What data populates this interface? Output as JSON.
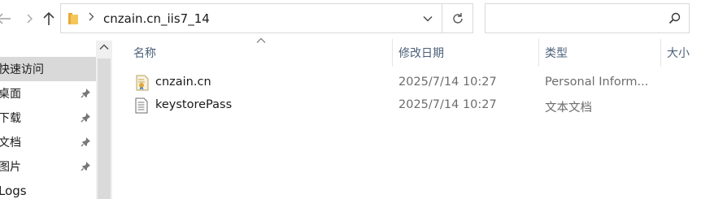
{
  "address": {
    "path": "cnzain.cn_iis7_14",
    "search_placeholder": ""
  },
  "icons": {
    "back": "arrow-left-icon",
    "forward": "chevron-right-icon",
    "up": "arrow-up-icon",
    "folder": "folder-icon",
    "dropdown": "chevron-down-icon",
    "refresh": "refresh-icon",
    "search": "search-icon",
    "pin": "pin-icon"
  },
  "nav": {
    "header": "快速访问",
    "items": [
      {
        "label": "桌面",
        "pinned": true
      },
      {
        "label": "下载",
        "pinned": true
      },
      {
        "label": "文档",
        "pinned": true
      },
      {
        "label": "图片",
        "pinned": true
      },
      {
        "label": "Logs",
        "pinned": false
      }
    ]
  },
  "columns": {
    "name": "名称",
    "date": "修改日期",
    "type": "类型",
    "size": "大小"
  },
  "files": [
    {
      "name": "cnzain.cn",
      "date": "2025/7/14 10:27",
      "type": "Personal Inform...",
      "icon": "certificate-file-icon"
    },
    {
      "name": "keystorePass",
      "date": "2025/7/14 10:27",
      "type": "文本文档",
      "icon": "text-file-icon"
    }
  ],
  "colors": {
    "header_text": "#4c607a",
    "nav_selected_bg": "#d9d9d9",
    "folder_yellow": "#f5c75a"
  }
}
